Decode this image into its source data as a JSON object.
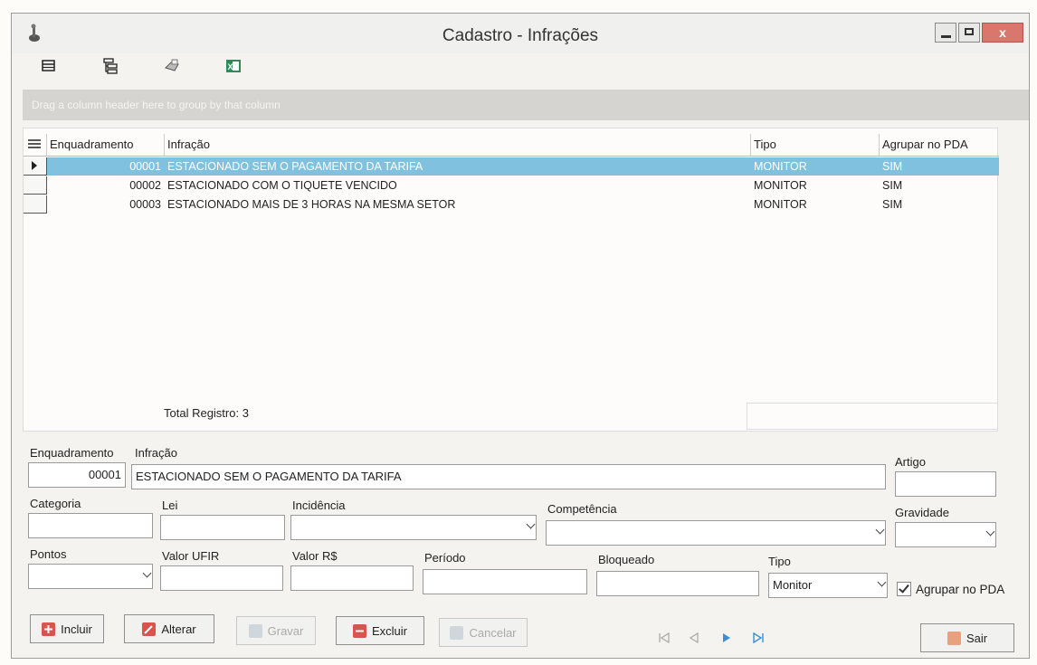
{
  "window": {
    "title": "Cadastro - Infrações",
    "close_label": "x"
  },
  "group_panel": {
    "hint": "Drag a column header here to group by that column"
  },
  "grid": {
    "columns": {
      "enquadramento": "Enquadramento",
      "infracao": "Infração",
      "tipo": "Tipo",
      "agrupar": "Agrupar no PDA"
    },
    "rows": [
      {
        "enquadramento": "00001",
        "infracao": "ESTACIONADO SEM O PAGAMENTO DA TARIFA",
        "tipo": "MONITOR",
        "agrupar": "SIM"
      },
      {
        "enquadramento": "00002",
        "infracao": "ESTACIONADO COM O TIQUETE VENCIDO",
        "tipo": "MONITOR",
        "agrupar": "SIM"
      },
      {
        "enquadramento": "00003",
        "infracao": "ESTACIONADO MAIS DE 3 HORAS NA MESMA SETOR",
        "tipo": "MONITOR",
        "agrupar": "SIM"
      }
    ],
    "total_label": "Total Registro: 3"
  },
  "form": {
    "enquadramento_label": "Enquadramento",
    "enquadramento_value": "00001",
    "infracao_label": "Infração",
    "infracao_value": "ESTACIONADO SEM O PAGAMENTO DA TARIFA",
    "artigo_label": "Artigo",
    "categoria_label": "Categoria",
    "lei_label": "Lei",
    "incidencia_label": "Incidência",
    "competencia_label": "Competência",
    "gravidade_label": "Gravidade",
    "pontos_label": "Pontos",
    "valor_ufir_label": "Valor UFIR",
    "valor_rs_label": "Valor R$",
    "periodo_label": "Período",
    "bloqueado_label": "Bloqueado",
    "tipo_label": "Tipo",
    "tipo_value": "Monitor",
    "agrupar_label": "Agrupar no PDA"
  },
  "buttons": {
    "incluir": "Incluir",
    "alterar": "Alterar",
    "gravar": "Gravar",
    "excluir": "Excluir",
    "cancelar": "Cancelar",
    "sair": "Sair"
  }
}
